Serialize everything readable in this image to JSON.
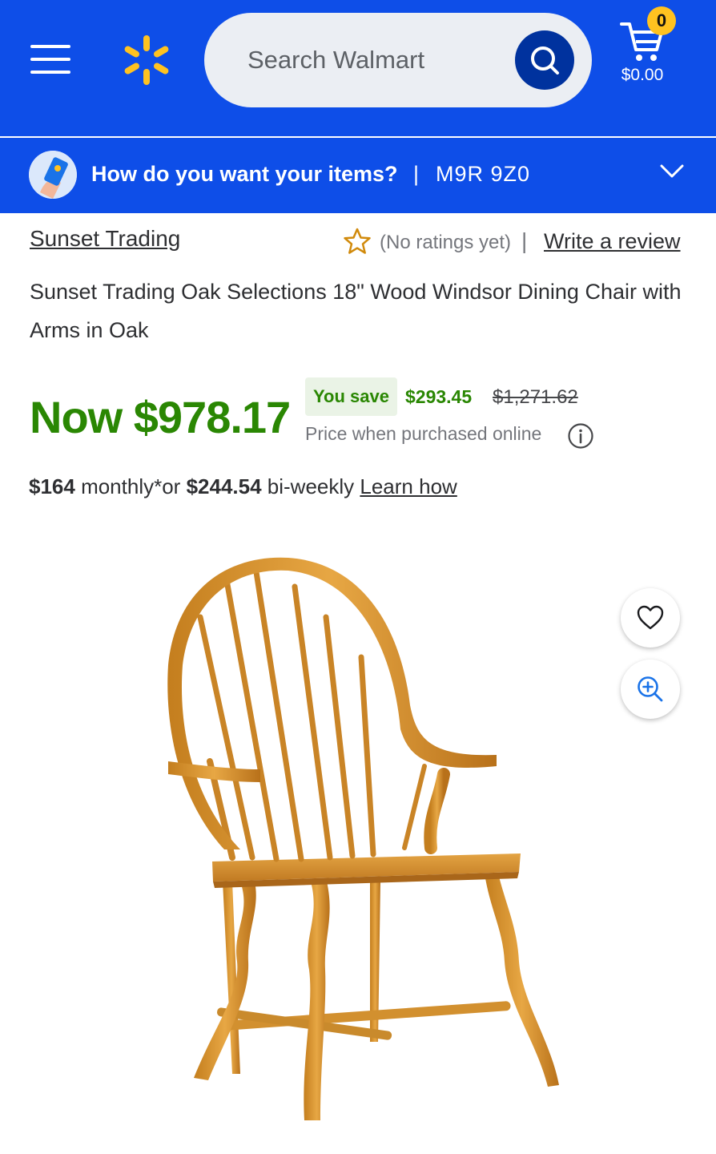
{
  "header": {
    "search_placeholder": "Search Walmart",
    "cart_count": "0",
    "cart_total": "$0.00",
    "brand_color": "#0e4ee8",
    "spark_color": "#ffc220"
  },
  "delivery": {
    "question": "How do you want your items?",
    "separator": "|",
    "postal_code": "M9R 9Z0"
  },
  "product": {
    "brand": "Sunset Trading",
    "rating_text": "(No ratings yet)",
    "rating_separator": "|",
    "write_review": "Write a review",
    "title": "Sunset Trading Oak Selections 18\" Wood Windsor Dining Chair with Arms in Oak"
  },
  "price": {
    "now": "Now $978.17",
    "you_save_label": "You save",
    "save_amount": "$293.45",
    "was": "$1,271.62",
    "note": "Price when purchased online",
    "accent": "#2a8703"
  },
  "finance": {
    "monthly_amount": "$164",
    "monthly_label": " monthly*or ",
    "biweekly_amount": "$244.54",
    "biweekly_label": " bi-weekly ",
    "learn_how": "Learn how"
  },
  "icons": {
    "favorite": "heart-icon",
    "zoom": "zoom-in-icon",
    "info": "info-icon",
    "cart": "cart-icon",
    "search": "search-icon",
    "menu": "hamburger-menu-icon",
    "rating": "star-icon"
  }
}
